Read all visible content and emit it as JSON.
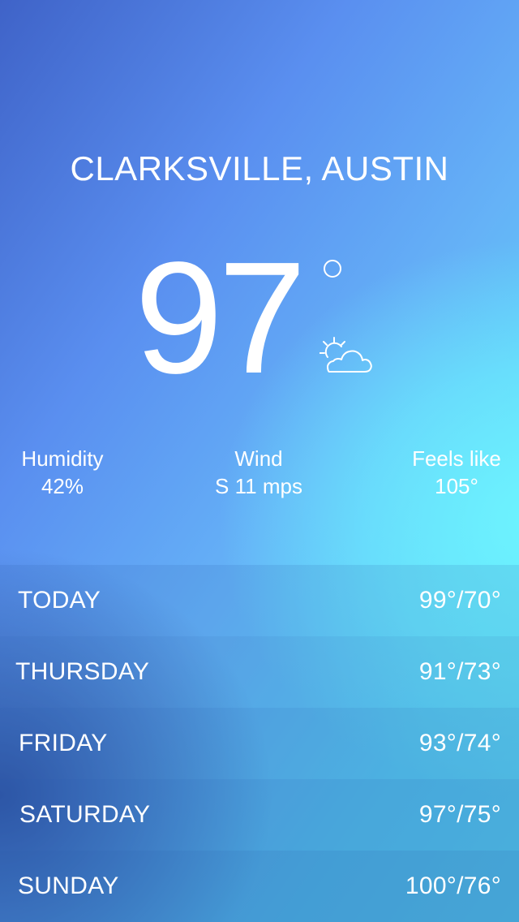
{
  "location": {
    "name": "CLARKSVILLE, AUSTIN"
  },
  "current": {
    "temperature": "97",
    "condition_icon": "partly-cloudy-icon",
    "humidity_label": "Humidity",
    "humidity_value": "42%",
    "wind_label": "Wind",
    "wind_value": "S 11 mps",
    "feels_like_label": "Feels like",
    "feels_like_value": "105°"
  },
  "forecast": [
    {
      "day": "TODAY",
      "hilo": "99°/70°"
    },
    {
      "day": "THURSDAY",
      "hilo": "91°/73°"
    },
    {
      "day": "FRIDAY",
      "hilo": "93°/74°"
    },
    {
      "day": "SATURDAY",
      "hilo": "97°/75°"
    },
    {
      "day": "SUNDAY",
      "hilo": "100°/76°"
    }
  ],
  "colors": {
    "background_top_left": "#3f63c8",
    "background_mid": "#65b2f7",
    "background_glow": "#6ef5ff",
    "text": "#ffffff"
  }
}
